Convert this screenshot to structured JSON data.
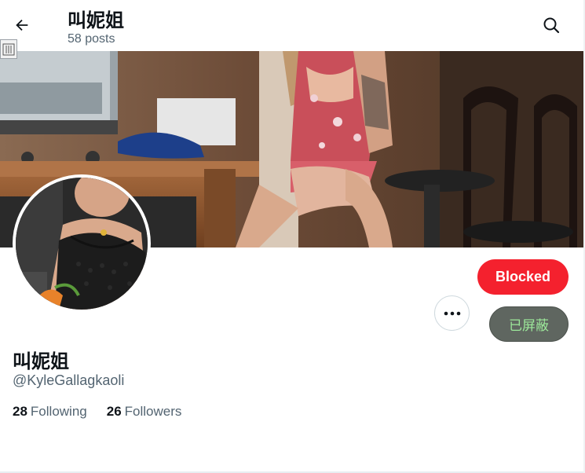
{
  "header": {
    "title": "叫妮姐",
    "posts_count": "58 posts",
    "back_icon": "arrow-left-icon",
    "search_icon": "search-icon"
  },
  "profile": {
    "display_name": "叫妮姐",
    "handle": "@KyleGallagkaoli",
    "following_count": "28",
    "following_label": "Following",
    "followers_count": "26",
    "followers_label": "Followers"
  },
  "actions": {
    "blocked_label": "Blocked",
    "more_icon": "more-horizontal-icon",
    "hide_label": "已屏蔽"
  },
  "colors": {
    "blocked_button": "#f4212e",
    "hide_button_bg": "#5f6660",
    "hide_button_text": "#9ce89a",
    "secondary_text": "#536471"
  }
}
